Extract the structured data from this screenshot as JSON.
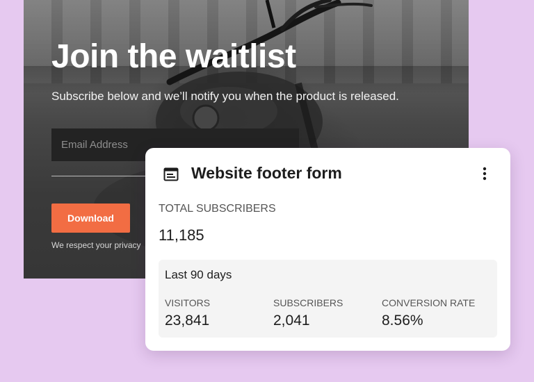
{
  "waitlist": {
    "title": "Join the waitlist",
    "subtitle": "Subscribe below and we’ll notify you when the product is released.",
    "email_placeholder": "Email Address",
    "email_value": "",
    "download_label": "Download",
    "privacy_text": "We respect your privacy"
  },
  "card": {
    "title": "Website footer form",
    "icon": "form-icon",
    "menu_icon": "more-vertical-icon",
    "total_label": "TOTAL SUBSCRIBERS",
    "total_value": "11,185",
    "period": {
      "title": "Last 90 days",
      "metrics": [
        {
          "label": "VISITORS",
          "value": "23,841"
        },
        {
          "label": "SUBSCRIBERS",
          "value": "2,041"
        },
        {
          "label": "CONVERSION RATE",
          "value": "8.56%"
        }
      ]
    }
  },
  "colors": {
    "page_background": "#e6c9f0",
    "accent_button": "#f26d43",
    "card_background": "#ffffff",
    "panel_background": "#f4f4f4"
  }
}
